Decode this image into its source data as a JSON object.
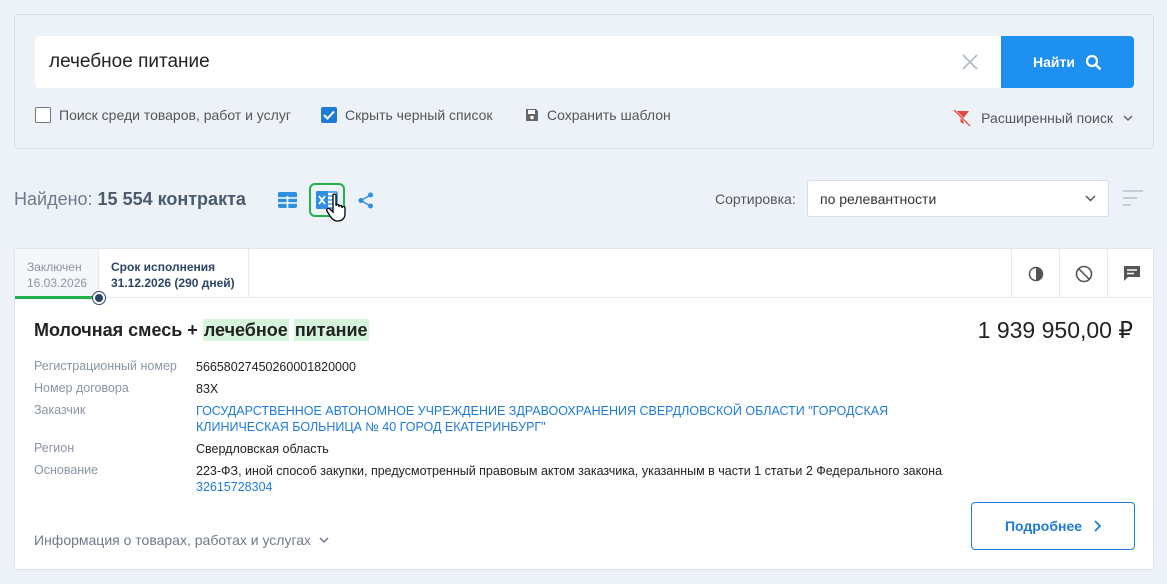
{
  "search": {
    "value": "лечебное питание",
    "button_label": "Найти",
    "options": {
      "goods": "Поиск среди товаров, работ и услуг",
      "hide_blacklist": "Скрыть черный список",
      "save_template": "Сохранить шаблон",
      "advanced": "Расширенный поиск"
    }
  },
  "results": {
    "found_label": "Найдено:",
    "found_count": "15 554 контракта",
    "sort_label": "Сортировка:",
    "sort_value": "по релевантности"
  },
  "card": {
    "stage_done_label": "Заключен",
    "stage_done_date": "16.03.2026",
    "stage_current_label": "Срок исполнения",
    "stage_current_date": "31.12.2026 (290 дней)",
    "title_prefix": "Молочная смесь +",
    "title_hl1": "лечебное",
    "title_hl2": "питание",
    "price": "1 939 950,00 ₽",
    "fields": {
      "reg_label": "Регистрационный номер",
      "reg_value": "56658027450260001820000",
      "contract_label": "Номер договора",
      "contract_value": "83Х",
      "customer_label": "Заказчик",
      "customer_value": "ГОСУДАРСТВЕННОЕ АВТОНОМНОЕ УЧРЕЖДЕНИЕ ЗДРАВООХРАНЕНИЯ СВЕРДЛОВСКОЙ ОБЛАСТИ \"ГОРОДСКАЯ КЛИНИЧЕСКАЯ БОЛЬНИЦА № 40 ГОРОД ЕКАТЕРИНБУРГ\"",
      "region_label": "Регион",
      "region_value": "Свердловская область",
      "basis_label": "Основание",
      "basis_value": "223-ФЗ, иной способ закупки, предусмотренный правовым актом заказчика, указанным в части 1 статьи 2 Федерального закона",
      "basis_link": "32615728304"
    },
    "more_info": "Информация о товарах, работах и услугах",
    "details_button": "Подробнее"
  },
  "colors": {
    "accent": "#1e90f0",
    "highlight": "#d6f3dc",
    "progress": "#22b14c"
  }
}
